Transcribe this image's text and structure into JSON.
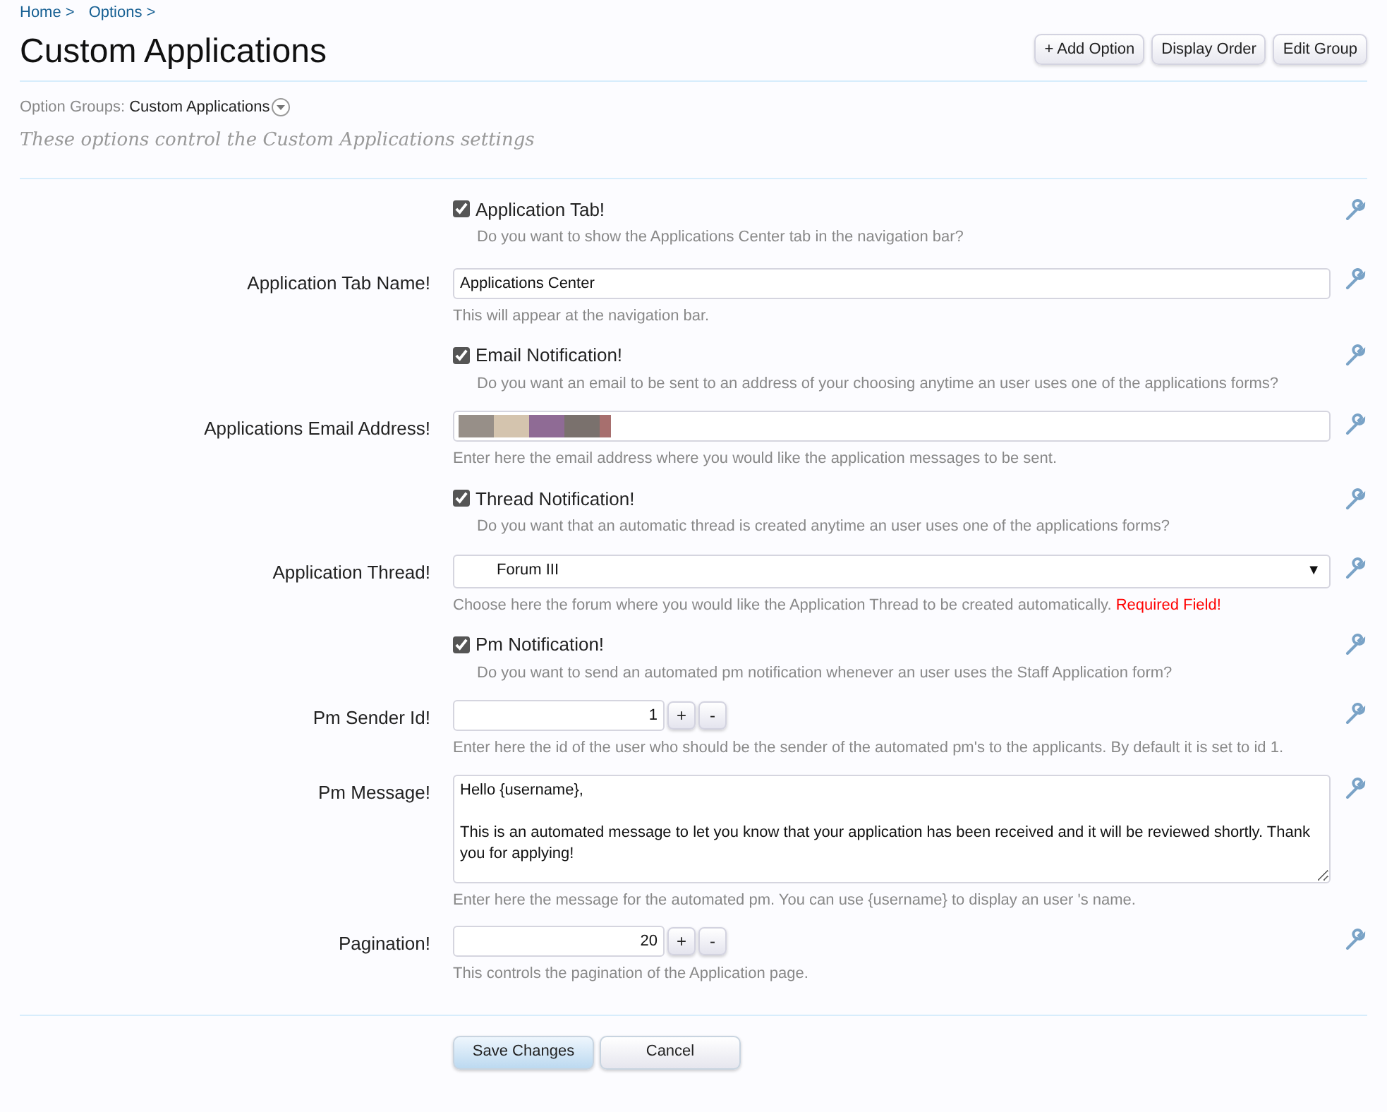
{
  "breadcrumb": [
    "Home >",
    "Options >"
  ],
  "title": "Custom Applications",
  "top_buttons": [
    "+ Add Option",
    "Display Order",
    "Edit Group"
  ],
  "option_groups": {
    "label": "Option Groups:",
    "value": "Custom Applications"
  },
  "description": "These options control the Custom Applications settings",
  "options": [
    {
      "kind": "checkbox",
      "label": "Application Tab!",
      "checked": true,
      "hint": "Do you want to show the Applications Center tab in the navigation bar?"
    },
    {
      "kind": "text",
      "label": "Application Tab Name!",
      "value": "Applications Center",
      "hint": "This will appear at the navigation bar."
    },
    {
      "kind": "checkbox",
      "label": "Email Notification!",
      "checked": true,
      "hint": "Do you want an email to be sent to an address of your choosing anytime an user uses one of the applications forms?"
    },
    {
      "kind": "text",
      "label": "Applications Email Address!",
      "redacted": true,
      "hint": "Enter here the email address where you would like the application messages to be sent."
    },
    {
      "kind": "checkbox",
      "label": "Thread Notification!",
      "checked": true,
      "hint": "Do you want that an automatic thread is created anytime an user uses one of the applications forms?"
    },
    {
      "kind": "select",
      "label": "Application Thread!",
      "value": "Forum III",
      "arrow": "▼",
      "hint": "Choose here the forum where you would like the Application Thread to be created automatically.",
      "required_note": "Required Field!"
    },
    {
      "kind": "checkbox",
      "label": "Pm Notification!",
      "checked": true,
      "hint": "Do you want to send an automated pm notification whenever an user uses the Staff Application form?"
    },
    {
      "kind": "spinner",
      "label": "Pm Sender Id!",
      "value": "1",
      "plus": "+",
      "minus": "-",
      "hint": "Enter here the id of the user who should be the sender of the automated pm's to the applicants. By default it is set to id 1."
    },
    {
      "kind": "textarea",
      "label": "Pm Message!",
      "value": "Hello {username},\n\nThis is an automated message to let you know that your application has been received and it will be reviewed shortly. Thank you for applying!",
      "hint": "Enter here the message for the automated pm. You can use {username} to display an user 's name."
    },
    {
      "kind": "spinner",
      "label": "Pagination!",
      "value": "20",
      "plus": "+",
      "minus": "-",
      "hint": "This controls the pagination of the Application page."
    }
  ],
  "footer_buttons": [
    {
      "label": "Save Changes",
      "primary": true
    },
    {
      "label": "Cancel",
      "primary": false
    }
  ]
}
